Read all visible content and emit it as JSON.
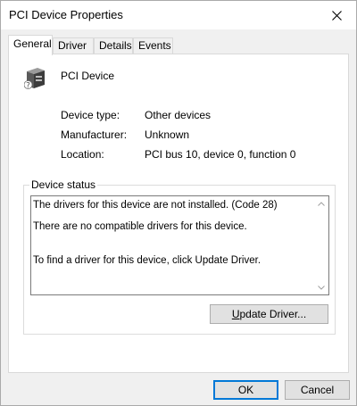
{
  "window": {
    "title": "PCI Device Properties"
  },
  "tabs": [
    {
      "label": "General",
      "active": true
    },
    {
      "label": "Driver",
      "active": false
    },
    {
      "label": "Details",
      "active": false
    },
    {
      "label": "Events",
      "active": false
    }
  ],
  "device": {
    "name": "PCI Device",
    "icon": "pci-device-icon"
  },
  "properties": [
    {
      "label": "Device type:",
      "value": "Other devices"
    },
    {
      "label": "Manufacturer:",
      "value": "Unknown"
    },
    {
      "label": "Location:",
      "value": "PCI bus 10, device 0, function 0"
    }
  ],
  "status": {
    "group_label": "Device status",
    "lines": [
      "The drivers for this device are not installed. (Code 28)",
      "There are no compatible drivers for this device.",
      "To find a driver for this device, click Update Driver."
    ]
  },
  "buttons": {
    "update_driver_underlined": "U",
    "update_driver_rest": "pdate Driver...",
    "ok": "OK",
    "cancel": "Cancel"
  },
  "colors": {
    "accent": "#0078d7",
    "dialog_bg": "#f0f0f0",
    "button_bg": "#e1e1e1"
  }
}
